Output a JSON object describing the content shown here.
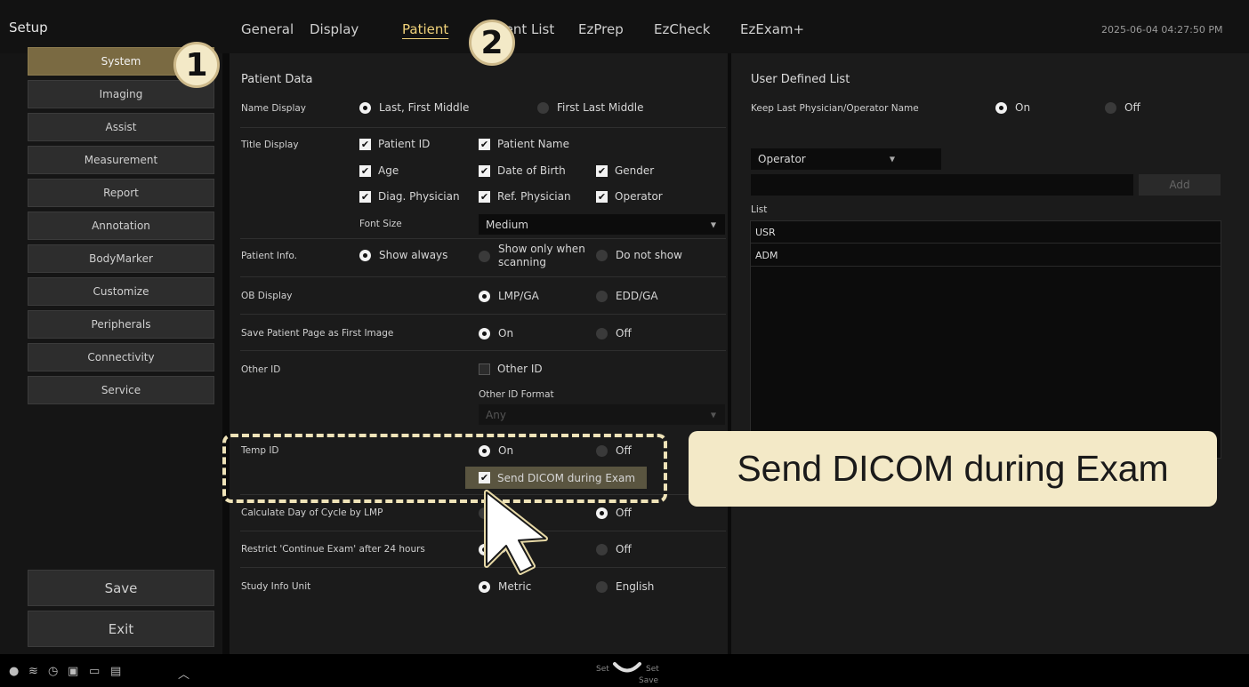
{
  "title": "Setup",
  "tabs": [
    "General",
    "Display",
    "Patient",
    "Patient List",
    "EzPrep",
    "EzCheck",
    "EzExam+"
  ],
  "active_tab": "Patient",
  "datetime": "2025-06-04 04:27:50 PM",
  "sidebar": {
    "items": [
      "System",
      "Imaging",
      "Assist",
      "Measurement",
      "Report",
      "Annotation",
      "BodyMarker",
      "Customize",
      "Peripherals",
      "Connectivity",
      "Service"
    ],
    "active": "System",
    "save": "Save",
    "exit": "Exit"
  },
  "patient_data": {
    "title": "Patient Data",
    "name_display": {
      "label": "Name Display",
      "options": [
        "Last, First Middle",
        "First Last Middle"
      ],
      "selected": "Last, First Middle"
    },
    "title_display": {
      "label": "Title Display",
      "checks": [
        "Patient ID",
        "Patient Name",
        "Age",
        "Date of Birth",
        "Gender",
        "Diag. Physician",
        "Ref. Physician",
        "Operator"
      ],
      "font_size_label": "Font Size",
      "font_size_value": "Medium"
    },
    "patient_info": {
      "label": "Patient Info.",
      "options": [
        "Show always",
        "Show only when scanning",
        "Do not show"
      ],
      "opt2_line1": "Show only when",
      "opt2_line2": "scanning",
      "selected": "Show always"
    },
    "ob_display": {
      "label": "OB Display",
      "options": [
        "LMP/GA",
        "EDD/GA"
      ],
      "selected": "LMP/GA"
    },
    "save_patient_page": {
      "label": "Save Patient Page as First Image",
      "options": [
        "On",
        "Off"
      ],
      "selected": "On"
    },
    "other_id": {
      "label": "Other ID",
      "check": "Other ID",
      "checked": false,
      "format_label": "Other ID Format",
      "format_value": "Any"
    },
    "temp_id": {
      "label": "Temp ID",
      "options": [
        "On",
        "Off"
      ],
      "selected": "On",
      "send_dicom": "Send DICOM during Exam",
      "send_dicom_checked": true
    },
    "calc_day": {
      "label": "Calculate Day of Cycle by LMP",
      "options": [
        "On",
        "Off"
      ],
      "selected": "Off"
    },
    "restrict_continue": {
      "label": "Restrict 'Continue Exam' after 24 hours",
      "options": [
        "On",
        "Off"
      ],
      "selected": "On"
    },
    "study_info_unit": {
      "label": "Study Info Unit",
      "options": [
        "Metric",
        "English"
      ],
      "selected": "Metric"
    }
  },
  "user_defined_list": {
    "title": "User Defined List",
    "keep_last": {
      "label": "Keep Last Physician/Operator Name",
      "options": [
        "On",
        "Off"
      ],
      "selected": "On"
    },
    "type_select": "Operator",
    "input_value": "",
    "add_button": "Add",
    "list_label": "List",
    "list_items": [
      "USR",
      "ADM"
    ]
  },
  "overlay": {
    "badge1": "1",
    "badge2": "2",
    "callout": "Send DICOM during Exam"
  },
  "status_bar": {
    "set_left": "Set",
    "set_right": "Set",
    "save": "Save"
  },
  "colors": {
    "active_tab": "#f0d27a",
    "sidebar_active": "#7a6a42",
    "callout_bg": "#f3e9c7"
  }
}
